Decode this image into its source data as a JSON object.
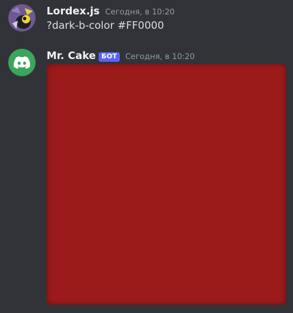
{
  "messages": [
    {
      "author": "Lordex.js",
      "timestamp": "Сегодня, в 10:20",
      "content": "?dark-b-color #FF0000",
      "avatar": {
        "icon": "user-avatar-icon"
      }
    },
    {
      "author": "Mr. Cake",
      "bot_tag": "БОТ",
      "timestamp": "Сегодня, в 10:20",
      "avatar": {
        "icon": "discord-logo-icon"
      },
      "attachment": {
        "type": "image",
        "color": "#9b1b1b"
      }
    }
  ],
  "colors": {
    "background": "#313338",
    "bot_tag_bg": "#5865f2",
    "bot_avatar_bg": "#3ba55c"
  }
}
